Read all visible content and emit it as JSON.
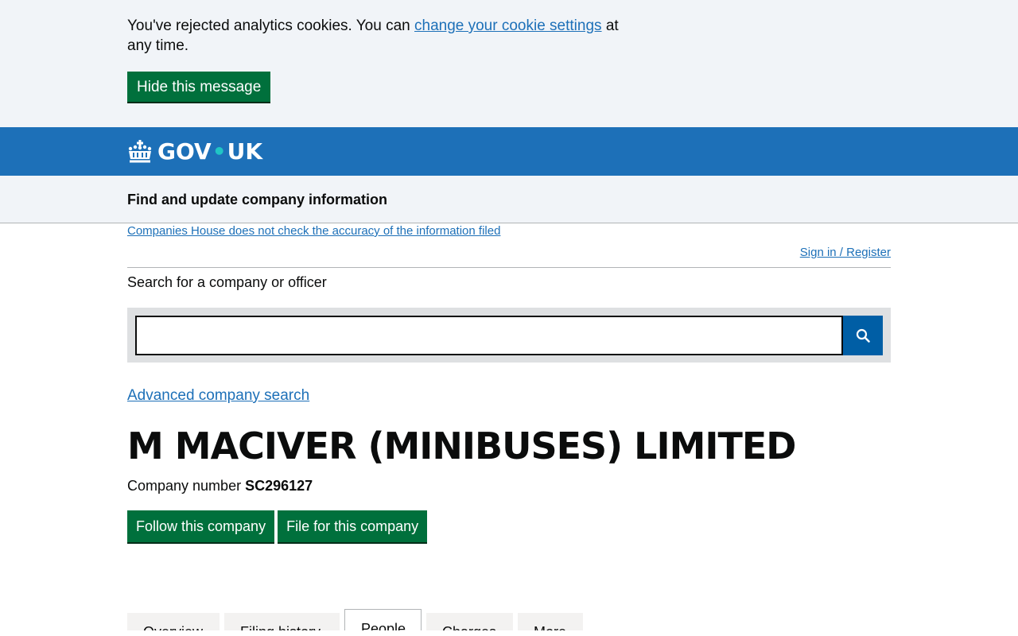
{
  "cookie_banner": {
    "text_before": "You've rejected analytics cookies. You can ",
    "link_text": "change your cookie settings",
    "text_after": " at any time.",
    "hide_button": "Hide this message"
  },
  "header": {
    "logo_text_gov": "GOV",
    "logo_dot": "•",
    "logo_text_uk": "UK",
    "service_name": "Find and update company information"
  },
  "notice": {
    "disclaimer_link": "Companies House does not check the accuracy of the information filed",
    "signin_link": "Sign in / Register"
  },
  "search": {
    "label": "Search for a company or officer",
    "value": "",
    "advanced_link": "Advanced company search"
  },
  "company": {
    "name": "M MACIVER (MINIBUSES) LIMITED",
    "number_label": "Company number",
    "number": "SC296127",
    "follow_button": "Follow this company",
    "file_button": "File for this company"
  },
  "tabs": [
    {
      "label": "Overview"
    },
    {
      "label": "Filing history"
    },
    {
      "label": "People"
    },
    {
      "label": "Charges"
    },
    {
      "label": "More"
    }
  ],
  "colors": {
    "header_blue": "#1d70b8",
    "button_green": "#00703c",
    "link_blue": "#1d70b8"
  }
}
